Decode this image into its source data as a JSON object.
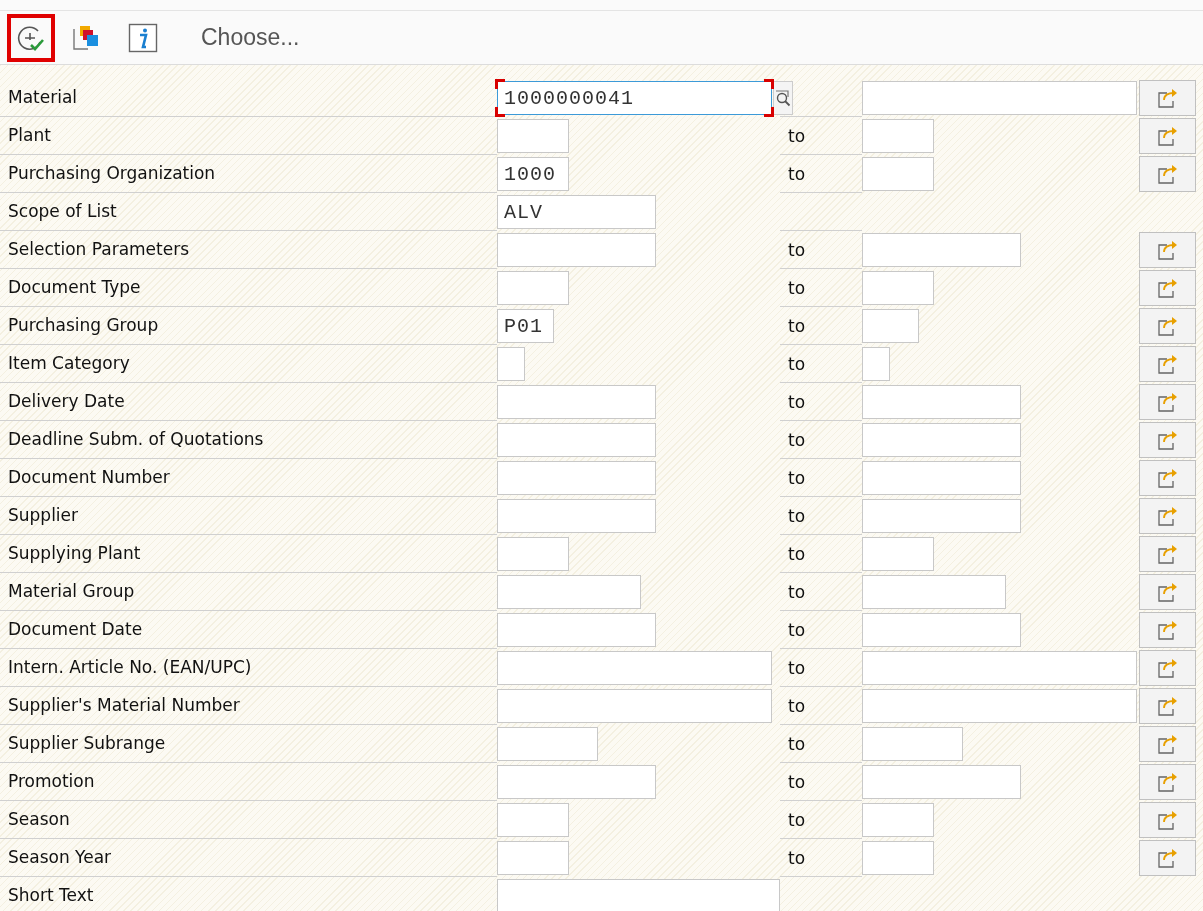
{
  "toolbar": {
    "buttons": [
      {
        "kind": "execute",
        "selected": true
      },
      {
        "kind": "variants",
        "selected": false
      },
      {
        "kind": "info",
        "selected": false
      }
    ],
    "menu_label": "Choose..."
  },
  "rows": [
    {
      "label": "Material",
      "low": {
        "value": "1000000041",
        "focused": true
      },
      "value_help": true,
      "high_field": true,
      "multiple_selection": true
    },
    {
      "label": "Plant",
      "low": {
        "focused": false
      },
      "value_help": false,
      "to_label": "to",
      "high_field": true,
      "multiple_selection": true
    },
    {
      "label": "Purchasing Organization",
      "low": {
        "value": "1000",
        "focused": false
      },
      "value_help": false,
      "to_label": "to",
      "high_field": true,
      "multiple_selection": true
    },
    {
      "label": "Scope of List",
      "low": {
        "value": "ALV",
        "focused": false
      },
      "value_help": false,
      "high_field": false,
      "multiple_selection": false
    },
    {
      "label": "Selection Parameters",
      "low": {
        "focused": false
      },
      "value_help": false,
      "to_label": "to",
      "high_field": true,
      "multiple_selection": true
    },
    {
      "label": "Document Type",
      "low": {
        "focused": false
      },
      "value_help": false,
      "to_label": "to",
      "high_field": true,
      "multiple_selection": true
    },
    {
      "label": "Purchasing Group",
      "low": {
        "value": "P01",
        "focused": false
      },
      "value_help": false,
      "to_label": "to",
      "high_field": true,
      "multiple_selection": true
    },
    {
      "label": "Item Category",
      "low": {
        "focused": false
      },
      "value_help": false,
      "to_label": "to",
      "high_field": true,
      "multiple_selection": true
    },
    {
      "label": "Delivery Date",
      "low": {
        "focused": false
      },
      "value_help": false,
      "to_label": "to",
      "high_field": true,
      "multiple_selection": true
    },
    {
      "label": "Deadline Subm. of Quotations",
      "low": {
        "focused": false
      },
      "value_help": false,
      "to_label": "to",
      "high_field": true,
      "multiple_selection": true
    },
    {
      "label": "Document Number",
      "low": {
        "focused": false
      },
      "value_help": false,
      "to_label": "to",
      "high_field": true,
      "multiple_selection": true
    },
    {
      "label": "Supplier",
      "low": {
        "focused": false
      },
      "value_help": false,
      "to_label": "to",
      "high_field": true,
      "multiple_selection": true
    },
    {
      "label": "Supplying Plant",
      "low": {
        "focused": false
      },
      "value_help": false,
      "to_label": "to",
      "high_field": true,
      "multiple_selection": true
    },
    {
      "label": "Material Group",
      "low": {
        "focused": false
      },
      "value_help": false,
      "to_label": "to",
      "high_field": true,
      "multiple_selection": true
    },
    {
      "label": "Document Date",
      "low": {
        "focused": false
      },
      "value_help": false,
      "to_label": "to",
      "high_field": true,
      "multiple_selection": true
    },
    {
      "label": "Intern. Article No. (EAN/UPC)",
      "low": {
        "focused": false
      },
      "value_help": false,
      "to_label": "to",
      "high_field": true,
      "multiple_selection": true
    },
    {
      "label": "Supplier's Material Number",
      "low": {
        "focused": false
      },
      "value_help": false,
      "to_label": "to",
      "high_field": true,
      "multiple_selection": true
    },
    {
      "label": "Supplier Subrange",
      "low": {
        "focused": false
      },
      "value_help": false,
      "to_label": "to",
      "high_field": true,
      "multiple_selection": true
    },
    {
      "label": "Promotion",
      "low": {
        "focused": false
      },
      "value_help": false,
      "to_label": "to",
      "high_field": true,
      "multiple_selection": true
    },
    {
      "label": "Season",
      "low": {
        "focused": false
      },
      "value_help": false,
      "to_label": "to",
      "high_field": true,
      "multiple_selection": true
    },
    {
      "label": "Season Year",
      "low": {
        "focused": false
      },
      "value_help": false,
      "to_label": "to",
      "high_field": true,
      "multiple_selection": true
    },
    {
      "label": "Short Text",
      "low": {
        "focused": false
      },
      "value_help": false,
      "high_field": false,
      "multiple_selection": false
    }
  ]
}
